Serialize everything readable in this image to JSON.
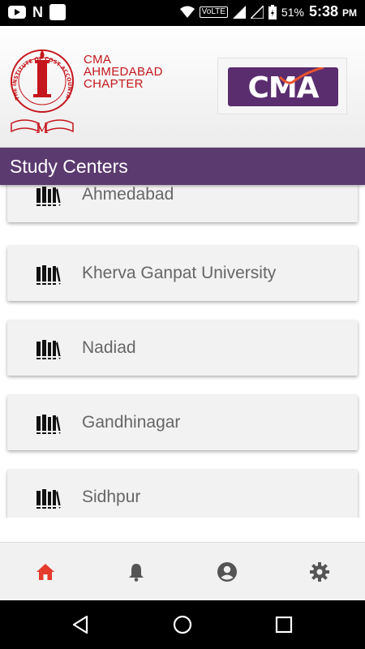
{
  "status_bar": {
    "battery": "51%",
    "time": "5:38",
    "ampm": "PM",
    "network": "VoLTE",
    "icons": [
      "youtube-icon",
      "n-icon",
      "app-square-icon",
      "wifi-icon",
      "signal-icon",
      "battery-icon"
    ]
  },
  "header": {
    "chapter_line1": "CMA",
    "chapter_line2": "AHMEDABAD",
    "chapter_line3": "CHAPTER",
    "seal_text": "THE INSTITUTE OF COST ACCOUNTANTS OF INDIA",
    "cma_logo_text": "CMA",
    "accent_color": "#c4161c",
    "brand_color": "#5b3b6f"
  },
  "section": {
    "title": "Study Centers"
  },
  "centers": [
    {
      "label": "Ahmedabad"
    },
    {
      "label": "Kherva Ganpat University"
    },
    {
      "label": "Nadiad"
    },
    {
      "label": "Gandhinagar"
    },
    {
      "label": "Sidhpur"
    }
  ],
  "bottom_nav": {
    "items": [
      {
        "icon": "home-icon",
        "active": true
      },
      {
        "icon": "bell-icon",
        "active": false
      },
      {
        "icon": "account-icon",
        "active": false
      },
      {
        "icon": "settings-icon",
        "active": false
      }
    ],
    "active_color": "#e53b2c",
    "inactive_color": "#555555"
  },
  "system_nav": {
    "icons": [
      "back-icon",
      "home-circle-icon",
      "recents-icon"
    ]
  }
}
